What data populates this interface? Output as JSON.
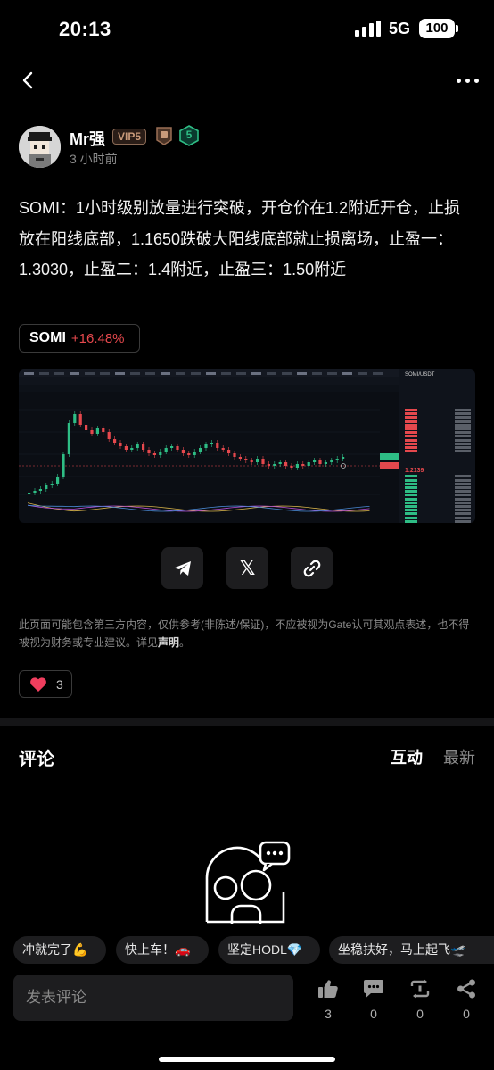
{
  "status_bar": {
    "time": "20:13",
    "network": "5G",
    "battery": "100"
  },
  "author": {
    "name": "Mr强",
    "vip": "VIP5",
    "level": "5",
    "time_ago": "3 小时前"
  },
  "post": {
    "text": "SOMI：1小时级别放量进行突破，开仓价在1.2附近开仓，止损放在阳线底部，1.1650跌破大阳线底部就止损离场，止盈一：1.3030，止盈二：1.4附近，止盈三：1.50附近",
    "coin": {
      "symbol": "SOMI",
      "change": "+16.48%"
    }
  },
  "chart_screenshot": {
    "pair": "SOMI/USDT",
    "last_price": "1.2139"
  },
  "share": {
    "telegram_icon": "telegram-icon",
    "x_icon": "𝕏",
    "link_icon": "link-icon"
  },
  "disclaimer": {
    "text": "此页面可能包含第三方内容，仅供参考(非陈述/保证)，不应被视为Gate认可其观点表述，也不得被视为财务或专业建议。详见",
    "link": "声明",
    "end": "。"
  },
  "reactions": {
    "likes": "3"
  },
  "comments": {
    "title": "评论",
    "sort_options": [
      "互动",
      "最新"
    ],
    "quick_replies": [
      "冲就完了💪",
      "快上车！🚗",
      "坚定HODL💎",
      "坐稳扶好，马上起飞🛫"
    ],
    "input_placeholder": "发表评论",
    "actions": [
      {
        "name": "thumbs-up",
        "count": "3"
      },
      {
        "name": "comment",
        "count": "0"
      },
      {
        "name": "repost",
        "count": "0"
      },
      {
        "name": "share",
        "count": "0"
      }
    ]
  },
  "colors": {
    "accent_red": "#e5484d",
    "accent_green": "#2ebd85",
    "surface": "#1d1d1f"
  }
}
